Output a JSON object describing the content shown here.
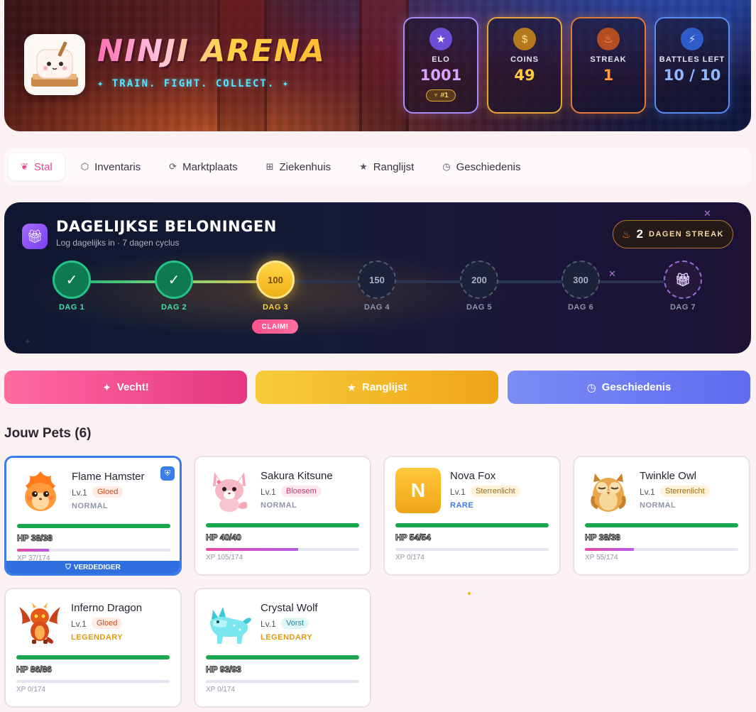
{
  "header": {
    "title": "NINJI ARENA",
    "tagline": "✦ TRAIN. FIGHT. COLLECT. ✦",
    "stats": {
      "elo": {
        "label": "ELO",
        "value": "1001",
        "rank": "♆ #1",
        "icon": "star-icon"
      },
      "coins": {
        "label": "COINS",
        "value": "49",
        "icon": "coin-icon"
      },
      "streak": {
        "label": "STREAK",
        "value": "1",
        "icon": "flame-icon"
      },
      "battles": {
        "label": "BATTLES LEFT",
        "value": "10 / 10",
        "icon": "lightning-icon"
      }
    }
  },
  "nav": {
    "tabs": [
      {
        "label": "Stal",
        "icon": "paw-icon",
        "active": true
      },
      {
        "label": "Inventaris",
        "icon": "box-icon"
      },
      {
        "label": "Marktplaats",
        "icon": "refresh-icon"
      },
      {
        "label": "Ziekenhuis",
        "icon": "plus-square-icon"
      },
      {
        "label": "Ranglijst",
        "icon": "star-icon"
      },
      {
        "label": "Geschiedenis",
        "icon": "clock-icon"
      }
    ]
  },
  "daily": {
    "title": "DAGELIJKSE BELONINGEN",
    "subtitle": "Log dagelijks in · 7 dagen cyclus",
    "streak_num": "2",
    "streak_text": "DAGEN STREAK",
    "claim": "CLAIM!",
    "days": [
      {
        "label": "DAG 1",
        "value": "✓",
        "state": "done"
      },
      {
        "label": "DAG 2",
        "value": "✓",
        "state": "done"
      },
      {
        "label": "DAG 3",
        "value": "100",
        "state": "current"
      },
      {
        "label": "DAG 4",
        "value": "150",
        "state": "locked"
      },
      {
        "label": "DAG 5",
        "value": "200",
        "state": "locked"
      },
      {
        "label": "DAG 6",
        "value": "300",
        "state": "locked"
      },
      {
        "label": "DAG 7",
        "value": "gift-icon",
        "state": "locked"
      }
    ]
  },
  "actions": {
    "fight": "Vecht!",
    "ranking": "Ranglijst",
    "history": "Geschiedenis"
  },
  "pets_title": "Jouw Pets (6)",
  "pets": [
    {
      "name": "Flame Hamster",
      "level": "Lv.1",
      "element": "Gloed",
      "rarity": "NORMAL",
      "hp": "HP 38/38",
      "xp": "XP 37/174",
      "xp_fraction": 0.21,
      "defender": "VERDEDIGER"
    },
    {
      "name": "Sakura Kitsune",
      "level": "Lv.1",
      "element": "Bloesem",
      "rarity": "NORMAL",
      "hp": "HP 40/40",
      "xp": "XP 105/174",
      "xp_fraction": 0.6
    },
    {
      "name": "Nova Fox",
      "level": "Lv.1",
      "element": "Sterrenlicht",
      "rarity": "RARE",
      "hp": "HP 54/54",
      "xp": "XP 0/174",
      "xp_fraction": 0,
      "avatar_letter": "N"
    },
    {
      "name": "Twinkle Owl",
      "level": "Lv.1",
      "element": "Sterrenlicht",
      "rarity": "NORMAL",
      "hp": "HP 38/38",
      "xp": "XP 55/174",
      "xp_fraction": 0.32
    },
    {
      "name": "Inferno Dragon",
      "level": "Lv.1",
      "element": "Gloed",
      "rarity": "LEGENDARY",
      "hp": "HP 86/86",
      "xp": "XP 0/174",
      "xp_fraction": 0
    },
    {
      "name": "Crystal Wolf",
      "level": "Lv.1",
      "element": "Vorst",
      "rarity": "LEGENDARY",
      "hp": "HP 93/93",
      "xp": "XP 0/174",
      "xp_fraction": 0
    }
  ]
}
